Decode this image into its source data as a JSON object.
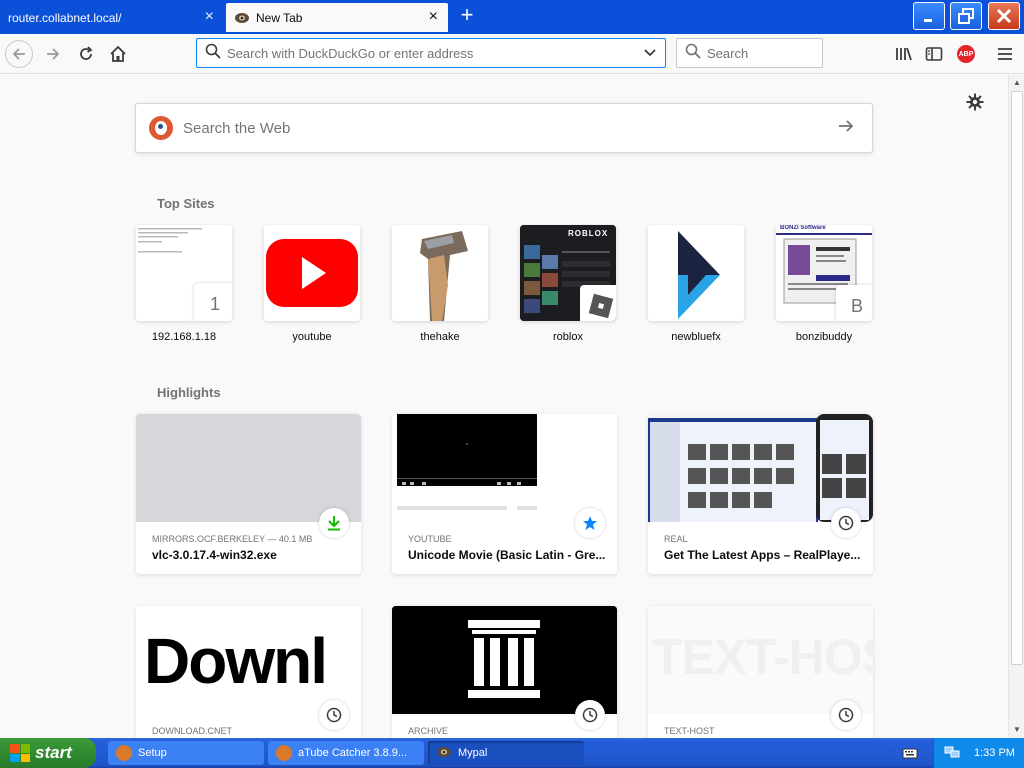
{
  "tabs": [
    {
      "title": "router.collabnet.local/"
    },
    {
      "title": "New Tab"
    }
  ],
  "icons": {
    "tab_close": "×",
    "new_tab": "+",
    "window_controls": [
      "minimize-icon",
      "restore-icon",
      "close-icon"
    ]
  },
  "toolbar": {
    "url_placeholder": "Search with DuckDuckGo or enter address",
    "search_placeholder": "Search",
    "abp_label": "ABP"
  },
  "newtab": {
    "web_search_placeholder": "Search the Web",
    "top_sites_heading": "Top Sites",
    "highlights_heading": "Highlights",
    "top_sites": [
      {
        "label": "192.168.1.18",
        "badge": "1"
      },
      {
        "label": "youtube"
      },
      {
        "label": "thehake"
      },
      {
        "label": "roblox",
        "thumb_text": "ROBLOX"
      },
      {
        "label": "newbluefx"
      },
      {
        "label": "bonzibuddy",
        "badge": "B",
        "thumb_text": "BONZI Software"
      }
    ],
    "highlights": [
      {
        "context": "MIRRORS.OCF.BERKELEY — 40.1 MB",
        "title": "vlc-3.0.17.4-win32.exe",
        "badge_icon": "download-icon"
      },
      {
        "context": "YOUTUBE",
        "title": "Unicode Movie (Basic Latin - Gre...",
        "badge_icon": "star-icon"
      },
      {
        "context": "REAL",
        "title": "Get The Latest Apps – RealPlaye...",
        "badge_icon": "clock-icon"
      },
      {
        "context": "DOWNLOAD.CNET",
        "title": "",
        "preview_text": "Downl",
        "badge_icon": "clock-icon"
      },
      {
        "context": "ARCHIVE",
        "title": "",
        "badge_icon": "clock-icon"
      },
      {
        "context": "TEXT-HOST",
        "title": "",
        "preview_text": "TEXT-HOST",
        "badge_icon": "clock-icon"
      }
    ]
  },
  "taskbar": {
    "start_label": "start",
    "items": [
      {
        "label": "Setup"
      },
      {
        "label": "aTube Catcher 3.8.9..."
      },
      {
        "label": "Mypal"
      }
    ],
    "clock": "1:33 PM"
  },
  "colors": {
    "accent": "#0a84ff",
    "titlebar": "#0a50d8",
    "taskbar": "#245edc",
    "start": "#3c9a3c"
  }
}
